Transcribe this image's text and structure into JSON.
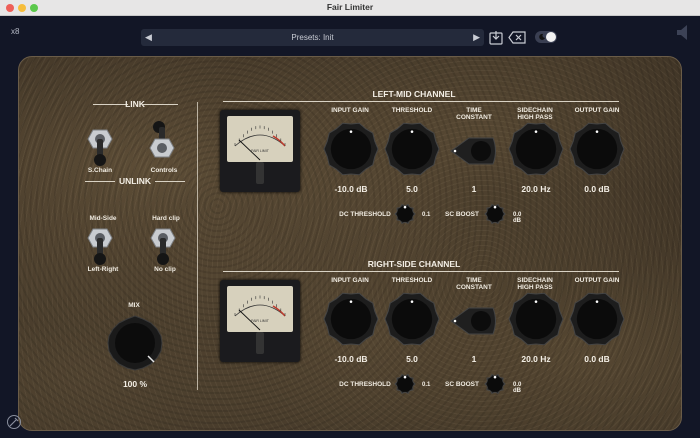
{
  "window": {
    "title": "Fair Limiter"
  },
  "header": {
    "oversampling": "x8",
    "preset_label": "Presets: Init"
  },
  "link": {
    "title": "LINK",
    "unlink_title": "UNLINK",
    "schain_label": "S.Chain",
    "controls_label": "Controls",
    "midside_label": "Mid-Side",
    "leftright_label": "Left-Right",
    "hardclip_label": "Hard clip",
    "noclip_label": "No clip"
  },
  "mix": {
    "label": "MIX",
    "value": "100 %"
  },
  "channels": [
    {
      "title": "LEFT-MID CHANNEL",
      "input_gain_label": "INPUT GAIN",
      "input_gain": "-10.0 dB",
      "threshold_label": "THRESHOLD",
      "threshold": "5.0",
      "time_constant_label_1": "TIME",
      "time_constant_label_2": "CONSTANT",
      "time_constant": "1",
      "sidechain_label_1": "SIDECHAIN",
      "sidechain_label_2": "HIGH PASS",
      "sidechain": "20.0 Hz",
      "output_gain_label": "OUTPUT GAIN",
      "output_gain": "0.0 dB",
      "dc_threshold_label": "DC THRESHOLD",
      "dc_threshold": "0.1",
      "sc_boost_label": "SC BOOST",
      "sc_boost": "0.0 dB"
    },
    {
      "title": "RIGHT-SIDE CHANNEL",
      "input_gain_label": "INPUT GAIN",
      "input_gain": "-10.0 dB",
      "threshold_label": "THRESHOLD",
      "threshold": "5.0",
      "time_constant_label_1": "TIME",
      "time_constant_label_2": "CONSTANT",
      "time_constant": "1",
      "sidechain_label_1": "SIDECHAIN",
      "sidechain_label_2": "HIGH PASS",
      "sidechain": "20.0 Hz",
      "output_gain_label": "OUTPUT GAIN",
      "output_gain": "0.0 dB",
      "dc_threshold_label": "DC THRESHOLD",
      "dc_threshold": "0.1",
      "sc_boost_label": "SC BOOST",
      "sc_boost": "0.0 dB"
    }
  ],
  "meter": {
    "brand": "FAIR LIMIT"
  },
  "colors": {
    "panel": "#3e3325",
    "text": "#f1ece2",
    "accent_red": "#c0392b"
  }
}
